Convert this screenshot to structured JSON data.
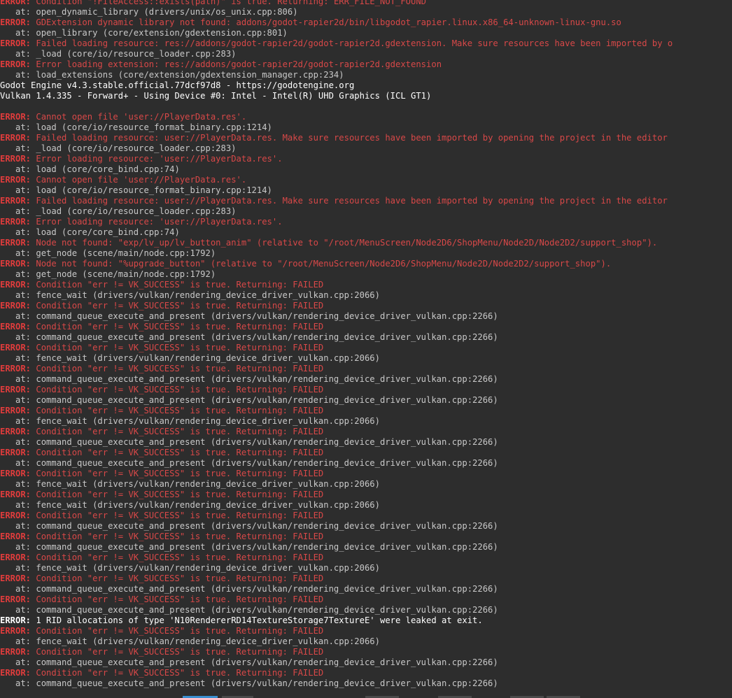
{
  "window": {
    "title": "Terminal"
  },
  "lines": [
    {
      "kind": "err",
      "prefix": "ERROR:",
      "text": " Condition \"!FileAccess::exists(path)\" is true. Returning: ERR_FILE_NOT_FOUND"
    },
    {
      "kind": "at",
      "text": "   at: open_dynamic_library (drivers/unix/os_unix.cpp:806)"
    },
    {
      "kind": "err",
      "prefix": "ERROR:",
      "text": " GDExtension dynamic library not found: addons/godot-rapier2d/bin/libgodot_rapier.linux.x86_64-unknown-linux-gnu.so"
    },
    {
      "kind": "at",
      "text": "   at: open_library (core/extension/gdextension.cpp:801)"
    },
    {
      "kind": "err",
      "prefix": "ERROR:",
      "text": " Failed loading resource: res://addons/godot-rapier2d/godot-rapier2d.gdextension. Make sure resources have been imported by o"
    },
    {
      "kind": "at",
      "text": "   at: _load (core/io/resource_loader.cpp:283)"
    },
    {
      "kind": "err",
      "prefix": "ERROR:",
      "text": " Error loading extension: res://addons/godot-rapier2d/godot-rapier2d.gdextension"
    },
    {
      "kind": "at",
      "text": "   at: load_extensions (core/extension/gdextension_manager.cpp:234)"
    },
    {
      "kind": "info",
      "text": "Godot Engine v4.3.stable.official.77dcf97d8 - https://godotengine.org"
    },
    {
      "kind": "info",
      "text": "Vulkan 1.4.335 - Forward+ - Using Device #0: Intel - Intel(R) UHD Graphics (ICL GT1)"
    },
    {
      "kind": "blank",
      "text": ""
    },
    {
      "kind": "err",
      "prefix": "ERROR:",
      "text": " Cannot open file 'user://PlayerData.res'."
    },
    {
      "kind": "at",
      "text": "   at: load (core/io/resource_format_binary.cpp:1214)"
    },
    {
      "kind": "err",
      "prefix": "ERROR:",
      "text": " Failed loading resource: user://PlayerData.res. Make sure resources have been imported by opening the project in the editor"
    },
    {
      "kind": "at",
      "text": "   at: _load (core/io/resource_loader.cpp:283)"
    },
    {
      "kind": "err",
      "prefix": "ERROR:",
      "text": " Error loading resource: 'user://PlayerData.res'."
    },
    {
      "kind": "at",
      "text": "   at: load (core/core_bind.cpp:74)"
    },
    {
      "kind": "err",
      "prefix": "ERROR:",
      "text": " Cannot open file 'user://PlayerData.res'."
    },
    {
      "kind": "at",
      "text": "   at: load (core/io/resource_format_binary.cpp:1214)"
    },
    {
      "kind": "err",
      "prefix": "ERROR:",
      "text": " Failed loading resource: user://PlayerData.res. Make sure resources have been imported by opening the project in the editor"
    },
    {
      "kind": "at",
      "text": "   at: _load (core/io/resource_loader.cpp:283)"
    },
    {
      "kind": "err",
      "prefix": "ERROR:",
      "text": " Error loading resource: 'user://PlayerData.res'."
    },
    {
      "kind": "at",
      "text": "   at: load (core/core_bind.cpp:74)"
    },
    {
      "kind": "err",
      "prefix": "ERROR:",
      "text": " Node not found: \"exp/lv_up/lv_button_anim\" (relative to \"/root/MenuScreen/Node2D6/ShopMenu/Node2D/Node2D2/support_shop\")."
    },
    {
      "kind": "at",
      "text": "   at: get_node (scene/main/node.cpp:1792)"
    },
    {
      "kind": "err",
      "prefix": "ERROR:",
      "text": " Node not found: \"%upgrade_button\" (relative to \"/root/MenuScreen/Node2D6/ShopMenu/Node2D/Node2D2/support_shop\")."
    },
    {
      "kind": "at",
      "text": "   at: get_node (scene/main/node.cpp:1792)"
    },
    {
      "kind": "err",
      "prefix": "ERROR:",
      "text": " Condition \"err != VK_SUCCESS\" is true. Returning: FAILED"
    },
    {
      "kind": "at",
      "text": "   at: fence_wait (drivers/vulkan/rendering_device_driver_vulkan.cpp:2066)"
    },
    {
      "kind": "err",
      "prefix": "ERROR:",
      "text": " Condition \"err != VK_SUCCESS\" is true. Returning: FAILED"
    },
    {
      "kind": "at",
      "text": "   at: command_queue_execute_and_present (drivers/vulkan/rendering_device_driver_vulkan.cpp:2266)"
    },
    {
      "kind": "err",
      "prefix": "ERROR:",
      "text": " Condition \"err != VK_SUCCESS\" is true. Returning: FAILED"
    },
    {
      "kind": "at",
      "text": "   at: command_queue_execute_and_present (drivers/vulkan/rendering_device_driver_vulkan.cpp:2266)"
    },
    {
      "kind": "err",
      "prefix": "ERROR:",
      "text": " Condition \"err != VK_SUCCESS\" is true. Returning: FAILED"
    },
    {
      "kind": "at",
      "text": "   at: fence_wait (drivers/vulkan/rendering_device_driver_vulkan.cpp:2066)"
    },
    {
      "kind": "err",
      "prefix": "ERROR:",
      "text": " Condition \"err != VK_SUCCESS\" is true. Returning: FAILED"
    },
    {
      "kind": "at",
      "text": "   at: command_queue_execute_and_present (drivers/vulkan/rendering_device_driver_vulkan.cpp:2266)"
    },
    {
      "kind": "err",
      "prefix": "ERROR:",
      "text": " Condition \"err != VK_SUCCESS\" is true. Returning: FAILED"
    },
    {
      "kind": "at",
      "text": "   at: command_queue_execute_and_present (drivers/vulkan/rendering_device_driver_vulkan.cpp:2266)"
    },
    {
      "kind": "err",
      "prefix": "ERROR:",
      "text": " Condition \"err != VK_SUCCESS\" is true. Returning: FAILED"
    },
    {
      "kind": "at",
      "text": "   at: fence_wait (drivers/vulkan/rendering_device_driver_vulkan.cpp:2066)"
    },
    {
      "kind": "err",
      "prefix": "ERROR:",
      "text": " Condition \"err != VK_SUCCESS\" is true. Returning: FAILED"
    },
    {
      "kind": "at",
      "text": "   at: command_queue_execute_and_present (drivers/vulkan/rendering_device_driver_vulkan.cpp:2266)"
    },
    {
      "kind": "err",
      "prefix": "ERROR:",
      "text": " Condition \"err != VK_SUCCESS\" is true. Returning: FAILED"
    },
    {
      "kind": "at",
      "text": "   at: command_queue_execute_and_present (drivers/vulkan/rendering_device_driver_vulkan.cpp:2266)"
    },
    {
      "kind": "err",
      "prefix": "ERROR:",
      "text": " Condition \"err != VK_SUCCESS\" is true. Returning: FAILED"
    },
    {
      "kind": "at",
      "text": "   at: fence_wait (drivers/vulkan/rendering_device_driver_vulkan.cpp:2066)"
    },
    {
      "kind": "err",
      "prefix": "ERROR:",
      "text": " Condition \"err != VK_SUCCESS\" is true. Returning: FAILED"
    },
    {
      "kind": "at",
      "text": "   at: fence_wait (drivers/vulkan/rendering_device_driver_vulkan.cpp:2066)"
    },
    {
      "kind": "err",
      "prefix": "ERROR:",
      "text": " Condition \"err != VK_SUCCESS\" is true. Returning: FAILED"
    },
    {
      "kind": "at",
      "text": "   at: command_queue_execute_and_present (drivers/vulkan/rendering_device_driver_vulkan.cpp:2266)"
    },
    {
      "kind": "err",
      "prefix": "ERROR:",
      "text": " Condition \"err != VK_SUCCESS\" is true. Returning: FAILED"
    },
    {
      "kind": "at",
      "text": "   at: command_queue_execute_and_present (drivers/vulkan/rendering_device_driver_vulkan.cpp:2266)"
    },
    {
      "kind": "err",
      "prefix": "ERROR:",
      "text": " Condition \"err != VK_SUCCESS\" is true. Returning: FAILED"
    },
    {
      "kind": "at",
      "text": "   at: fence_wait (drivers/vulkan/rendering_device_driver_vulkan.cpp:2066)"
    },
    {
      "kind": "err",
      "prefix": "ERROR:",
      "text": " Condition \"err != VK_SUCCESS\" is true. Returning: FAILED"
    },
    {
      "kind": "at",
      "text": "   at: command_queue_execute_and_present (drivers/vulkan/rendering_device_driver_vulkan.cpp:2266)"
    },
    {
      "kind": "err",
      "prefix": "ERROR:",
      "text": " Condition \"err != VK_SUCCESS\" is true. Returning: FAILED"
    },
    {
      "kind": "at",
      "text": "   at: command_queue_execute_and_present (drivers/vulkan/rendering_device_driver_vulkan.cpp:2266)"
    },
    {
      "kind": "errwhite",
      "prefix": "ERROR:",
      "text": " 1 RID allocations of type 'N10RendererRD14TextureStorage7TextureE' were leaked at exit."
    },
    {
      "kind": "err",
      "prefix": "ERROR:",
      "text": " Condition \"err != VK_SUCCESS\" is true. Returning: FAILED"
    },
    {
      "kind": "at",
      "text": "   at: fence_wait (drivers/vulkan/rendering_device_driver_vulkan.cpp:2066)"
    },
    {
      "kind": "err",
      "prefix": "ERROR:",
      "text": " Condition \"err != VK_SUCCESS\" is true. Returning: FAILED"
    },
    {
      "kind": "at",
      "text": "   at: command_queue_execute_and_present (drivers/vulkan/rendering_device_driver_vulkan.cpp:2266)"
    },
    {
      "kind": "err",
      "prefix": "ERROR:",
      "text": " Condition \"err != VK_SUCCESS\" is true. Returning: FAILED"
    },
    {
      "kind": "at",
      "text": "   at: command_queue_execute_and_present (drivers/vulkan/rendering_device_driver_vulkan.cpp:2266)"
    }
  ],
  "colors": {
    "background": "#2d2d2d",
    "error_prefix": "#e03c3c",
    "error_text": "#d84848",
    "at_text": "#c8c8c8",
    "info_text": "#ffffff"
  }
}
